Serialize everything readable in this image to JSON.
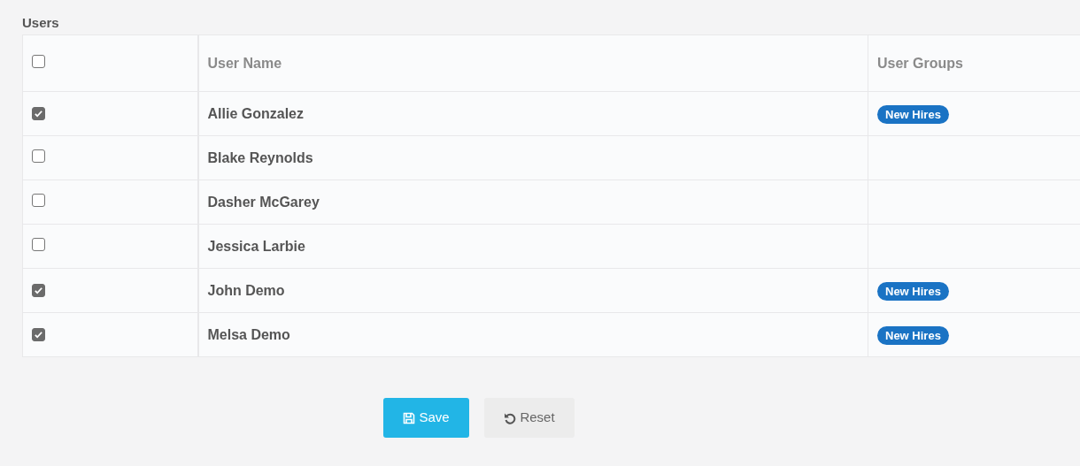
{
  "section_title": "Users",
  "table": {
    "select_all": {
      "checked": false
    },
    "columns": [
      "User Name",
      "User Groups"
    ],
    "rows": [
      {
        "checked": true,
        "name": "Allie Gonzalez",
        "groups": [
          "New Hires"
        ]
      },
      {
        "checked": false,
        "name": "Blake Reynolds",
        "groups": []
      },
      {
        "checked": false,
        "name": "Dasher McGarey",
        "groups": []
      },
      {
        "checked": false,
        "name": "Jessica Larbie",
        "groups": []
      },
      {
        "checked": true,
        "name": "John Demo",
        "groups": [
          "New Hires"
        ]
      },
      {
        "checked": true,
        "name": "Melsa Demo",
        "groups": [
          "New Hires"
        ]
      }
    ]
  },
  "buttons": [
    {
      "kind": "save",
      "label": "Save"
    },
    {
      "kind": "reset",
      "label": "Reset"
    }
  ]
}
